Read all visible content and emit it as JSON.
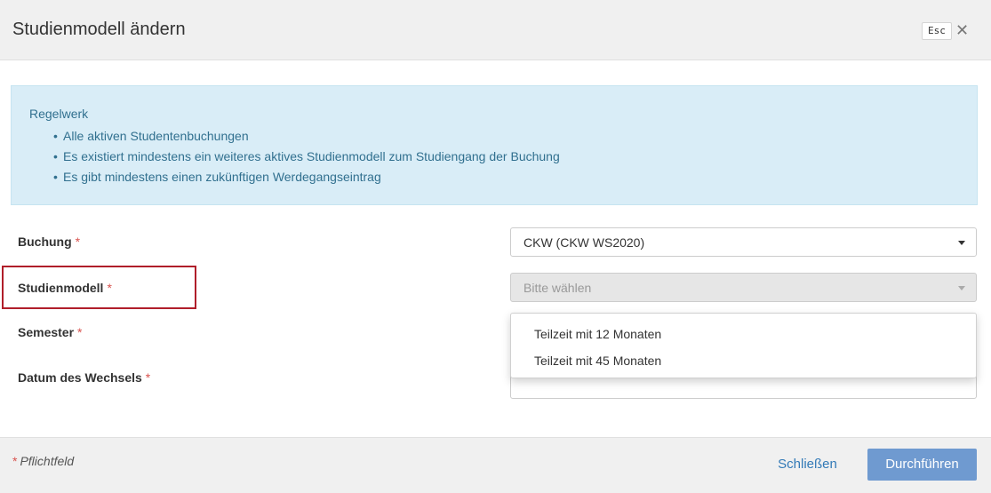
{
  "modal": {
    "title": "Studienmodell ändern",
    "esc_label": "Esc",
    "close_icon": "close-icon",
    "close_glyph": "✕"
  },
  "alert": {
    "title": "Regelwerk",
    "items": [
      "Alle aktiven Studentenbuchungen",
      "Es existiert mindestens ein weiteres aktives Studienmodell zum Studiengang der Buchung",
      "Es gibt mindestens einen zukünftigen Werdegangseintrag"
    ],
    "bg_color": "#d9edf7",
    "text_color": "#31708f"
  },
  "form": {
    "required_marker": "*",
    "buchung": {
      "label": "Buchung",
      "value": "CKW (CKW WS2020)"
    },
    "studienmodell": {
      "label": "Studienmodell",
      "placeholder": "Bitte wählen",
      "disabled": true,
      "highlighted": true
    },
    "semester": {
      "label": "Semester"
    },
    "datum": {
      "label": "Datum des Wechsels"
    }
  },
  "dropdown": {
    "options": [
      "Teilzeit mit 12 Monaten",
      "Teilzeit mit 45 Monaten"
    ]
  },
  "footer": {
    "required_star": "*",
    "required_note": "Pflichtfeld",
    "close_label": "Schließen",
    "submit_label": "Durchführen",
    "submit_color": "#6f9ad0"
  }
}
